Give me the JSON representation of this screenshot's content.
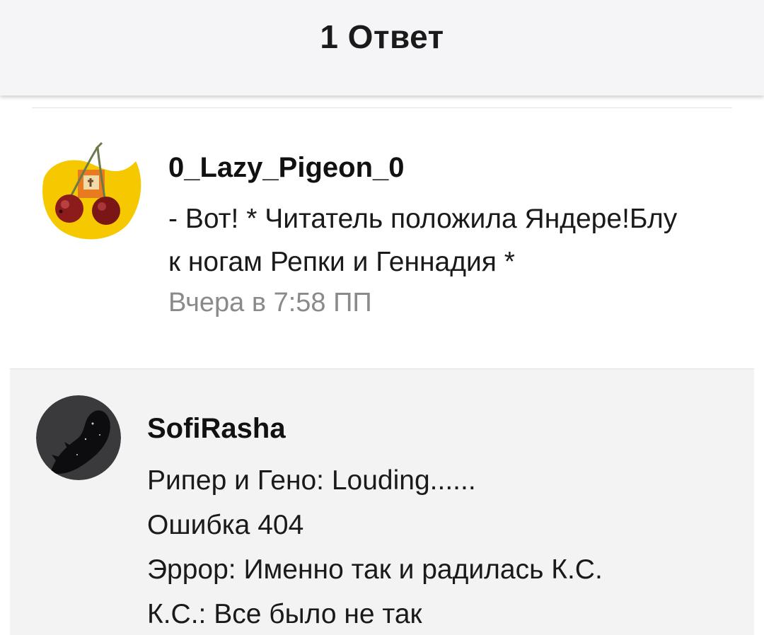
{
  "header": {
    "title": "1 Ответ"
  },
  "comment": {
    "author": "0_Lazy_Pigeon_0",
    "avatar_icon": "cherries-icon",
    "lines": [
      "- Вот! * Читатель положила Яндере!Блу",
      "к ногам Репки и Геннадия *"
    ],
    "timestamp": "Вчера в 7:58 ПП"
  },
  "reply": {
    "author": "SofiRasha",
    "avatar_icon": "dark-creature-icon",
    "lines": [
      "Рипер и Гено: Louding......",
      "Ошибка 404",
      "Эррор: Именно так и радилась К.С.",
      "К.С.: Все было не так"
    ]
  },
  "colors": {
    "header_bg": "#f5f5f7",
    "reply_bg": "#f3f3f4",
    "timestamp": "#8a8a8a",
    "avatar_yellow": "#f6c800"
  }
}
